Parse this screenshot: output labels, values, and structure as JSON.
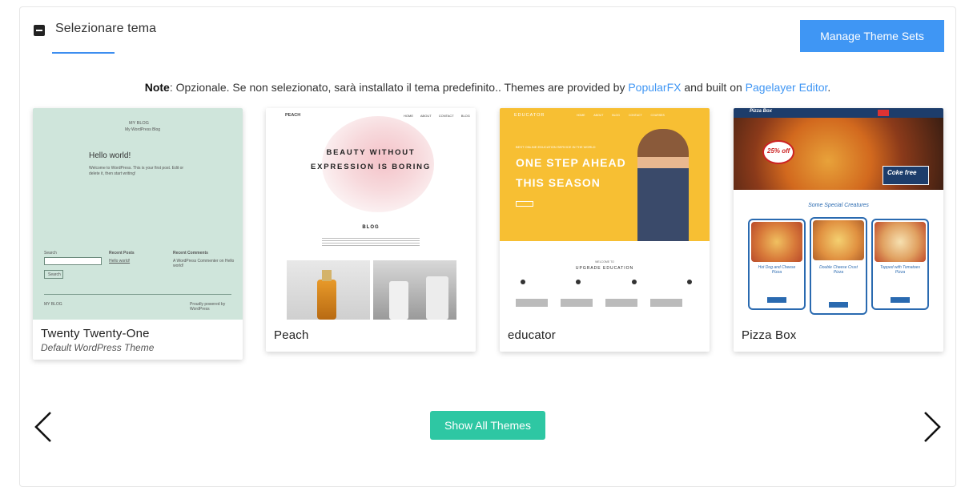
{
  "header": {
    "title": "Selezionare tema",
    "manage_button": "Manage Theme Sets",
    "toggle_icon": "minus-square-icon"
  },
  "note": {
    "label": "Note",
    "text_before": ": Opzionale. Se non selezionato, sarà installato il tema predefinito.. Themes are provided by ",
    "link1": "PopularFX",
    "text_middle": " and built on ",
    "link2": "Pagelayer Editor",
    "text_after": ".",
    "link_color": "#3f96f4"
  },
  "themes": [
    {
      "name": "Twenty Twenty-One",
      "subtitle": "Default WordPress Theme",
      "preview": {
        "blog": "MY BLOG",
        "tagline": "My WordPress Blog",
        "heading": "Hello world!",
        "body": "Welcome to WordPress. This is your first post. Edit or delete it, then start writing!",
        "search_label": "Search",
        "search_button": "Search",
        "recent_posts": "Recent Posts",
        "recent_post_item": "Hello world!",
        "recent_comments": "Recent Comments",
        "recent_comment_item": "A WordPress Commenter on Hello world!",
        "footer_left": "MY BLOG",
        "footer_right": "Proudly powered by WordPress"
      }
    },
    {
      "name": "Peach",
      "subtitle": "",
      "preview": {
        "logo": "PEACH",
        "nav": [
          "HOME",
          "ABOUT",
          "CONTACT",
          "BLOG"
        ],
        "headline1": "BEAUTY WITHOUT",
        "headline2": "EXPRESSION IS BORING",
        "section": "BLOG"
      }
    },
    {
      "name": "educator",
      "subtitle": "",
      "preview": {
        "logo": "EDUCATOR",
        "kicker": "BEST ONLINE EDUCATION SERVICE IN THE WORLD",
        "headline1": "ONE STEP AHEAD",
        "headline2": "THIS SEASON",
        "welcome": "WELCOME TO",
        "section": "UPGRADE EDUCATION",
        "features": [
          "Award & Annoted",
          "The Experts",
          "Best Courses",
          "Books & Library"
        ]
      }
    },
    {
      "name": "Pizza Box",
      "subtitle": "",
      "preview": {
        "logo": "Pizza Box",
        "discount": "25% off",
        "coke": "Coke free",
        "section": "Some Special Creatures",
        "items": [
          "Hot Dog and Cheese Pizza",
          "Double Cheese Crust Pizza",
          "Topped with Tomatoes Pizza"
        ],
        "order": "ORDER NOW"
      }
    }
  ],
  "footer": {
    "show_all": "Show All Themes",
    "prev_icon": "chevron-left-icon",
    "next_icon": "chevron-right-icon"
  },
  "colors": {
    "accent_blue": "#3f96f4",
    "teal": "#2ec7a3",
    "mint": "#cfe5db",
    "educator_yellow": "#f7bf33",
    "pizza_navy": "#1d3d6b"
  }
}
